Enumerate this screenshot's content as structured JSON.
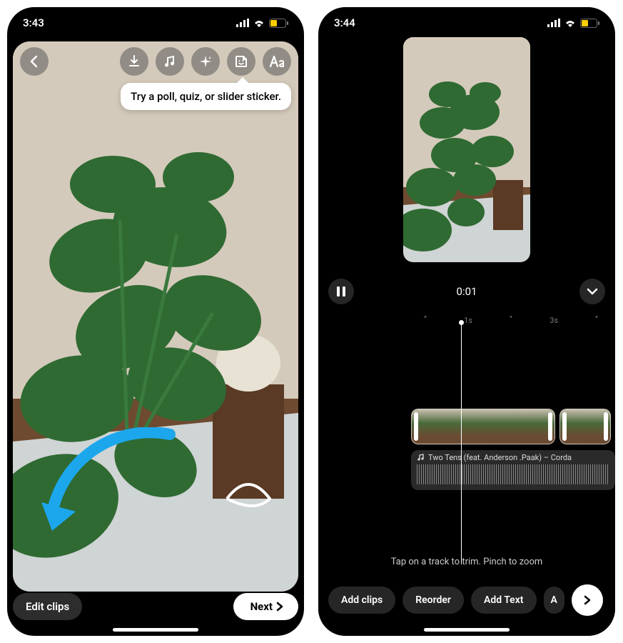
{
  "left": {
    "status": {
      "time": "3:43"
    },
    "toolbar_icons": [
      "download-icon",
      "music-icon",
      "sparkle-icon",
      "sticker-icon",
      "text-aa-icon"
    ],
    "tooltip": "Try a poll, quiz, or slider sticker.",
    "edit_button": "Edit clips",
    "next_button": "Next"
  },
  "right": {
    "status": {
      "time": "3:44"
    },
    "playback_time": "0:01",
    "ruler_labels": [
      "1s",
      "3s"
    ],
    "audio_track": "Two Tens (feat. Anderson .Paak) – Corda",
    "hint": "Tap on a track to trim. Pinch to zoom",
    "actions": [
      "Add clips",
      "Reorder",
      "Add Text",
      "A"
    ]
  }
}
